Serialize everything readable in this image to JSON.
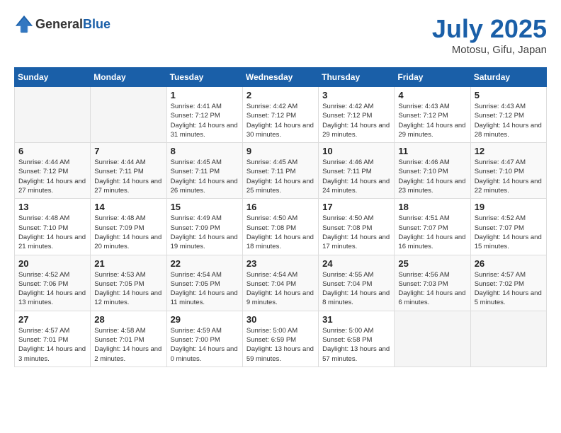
{
  "header": {
    "logo_general": "General",
    "logo_blue": "Blue",
    "month_year": "July 2025",
    "location": "Motosu, Gifu, Japan"
  },
  "days_of_week": [
    "Sunday",
    "Monday",
    "Tuesday",
    "Wednesday",
    "Thursday",
    "Friday",
    "Saturday"
  ],
  "weeks": [
    [
      {
        "day": "",
        "info": ""
      },
      {
        "day": "",
        "info": ""
      },
      {
        "day": "1",
        "info": "Sunrise: 4:41 AM\nSunset: 7:12 PM\nDaylight: 14 hours\nand 31 minutes."
      },
      {
        "day": "2",
        "info": "Sunrise: 4:42 AM\nSunset: 7:12 PM\nDaylight: 14 hours\nand 30 minutes."
      },
      {
        "day": "3",
        "info": "Sunrise: 4:42 AM\nSunset: 7:12 PM\nDaylight: 14 hours\nand 29 minutes."
      },
      {
        "day": "4",
        "info": "Sunrise: 4:43 AM\nSunset: 7:12 PM\nDaylight: 14 hours\nand 29 minutes."
      },
      {
        "day": "5",
        "info": "Sunrise: 4:43 AM\nSunset: 7:12 PM\nDaylight: 14 hours\nand 28 minutes."
      }
    ],
    [
      {
        "day": "6",
        "info": "Sunrise: 4:44 AM\nSunset: 7:12 PM\nDaylight: 14 hours\nand 27 minutes."
      },
      {
        "day": "7",
        "info": "Sunrise: 4:44 AM\nSunset: 7:11 PM\nDaylight: 14 hours\nand 27 minutes."
      },
      {
        "day": "8",
        "info": "Sunrise: 4:45 AM\nSunset: 7:11 PM\nDaylight: 14 hours\nand 26 minutes."
      },
      {
        "day": "9",
        "info": "Sunrise: 4:45 AM\nSunset: 7:11 PM\nDaylight: 14 hours\nand 25 minutes."
      },
      {
        "day": "10",
        "info": "Sunrise: 4:46 AM\nSunset: 7:11 PM\nDaylight: 14 hours\nand 24 minutes."
      },
      {
        "day": "11",
        "info": "Sunrise: 4:46 AM\nSunset: 7:10 PM\nDaylight: 14 hours\nand 23 minutes."
      },
      {
        "day": "12",
        "info": "Sunrise: 4:47 AM\nSunset: 7:10 PM\nDaylight: 14 hours\nand 22 minutes."
      }
    ],
    [
      {
        "day": "13",
        "info": "Sunrise: 4:48 AM\nSunset: 7:10 PM\nDaylight: 14 hours\nand 21 minutes."
      },
      {
        "day": "14",
        "info": "Sunrise: 4:48 AM\nSunset: 7:09 PM\nDaylight: 14 hours\nand 20 minutes."
      },
      {
        "day": "15",
        "info": "Sunrise: 4:49 AM\nSunset: 7:09 PM\nDaylight: 14 hours\nand 19 minutes."
      },
      {
        "day": "16",
        "info": "Sunrise: 4:50 AM\nSunset: 7:08 PM\nDaylight: 14 hours\nand 18 minutes."
      },
      {
        "day": "17",
        "info": "Sunrise: 4:50 AM\nSunset: 7:08 PM\nDaylight: 14 hours\nand 17 minutes."
      },
      {
        "day": "18",
        "info": "Sunrise: 4:51 AM\nSunset: 7:07 PM\nDaylight: 14 hours\nand 16 minutes."
      },
      {
        "day": "19",
        "info": "Sunrise: 4:52 AM\nSunset: 7:07 PM\nDaylight: 14 hours\nand 15 minutes."
      }
    ],
    [
      {
        "day": "20",
        "info": "Sunrise: 4:52 AM\nSunset: 7:06 PM\nDaylight: 14 hours\nand 13 minutes."
      },
      {
        "day": "21",
        "info": "Sunrise: 4:53 AM\nSunset: 7:05 PM\nDaylight: 14 hours\nand 12 minutes."
      },
      {
        "day": "22",
        "info": "Sunrise: 4:54 AM\nSunset: 7:05 PM\nDaylight: 14 hours\nand 11 minutes."
      },
      {
        "day": "23",
        "info": "Sunrise: 4:54 AM\nSunset: 7:04 PM\nDaylight: 14 hours\nand 9 minutes."
      },
      {
        "day": "24",
        "info": "Sunrise: 4:55 AM\nSunset: 7:04 PM\nDaylight: 14 hours\nand 8 minutes."
      },
      {
        "day": "25",
        "info": "Sunrise: 4:56 AM\nSunset: 7:03 PM\nDaylight: 14 hours\nand 6 minutes."
      },
      {
        "day": "26",
        "info": "Sunrise: 4:57 AM\nSunset: 7:02 PM\nDaylight: 14 hours\nand 5 minutes."
      }
    ],
    [
      {
        "day": "27",
        "info": "Sunrise: 4:57 AM\nSunset: 7:01 PM\nDaylight: 14 hours\nand 3 minutes."
      },
      {
        "day": "28",
        "info": "Sunrise: 4:58 AM\nSunset: 7:01 PM\nDaylight: 14 hours\nand 2 minutes."
      },
      {
        "day": "29",
        "info": "Sunrise: 4:59 AM\nSunset: 7:00 PM\nDaylight: 14 hours\nand 0 minutes."
      },
      {
        "day": "30",
        "info": "Sunrise: 5:00 AM\nSunset: 6:59 PM\nDaylight: 13 hours\nand 59 minutes."
      },
      {
        "day": "31",
        "info": "Sunrise: 5:00 AM\nSunset: 6:58 PM\nDaylight: 13 hours\nand 57 minutes."
      },
      {
        "day": "",
        "info": ""
      },
      {
        "day": "",
        "info": ""
      }
    ]
  ]
}
